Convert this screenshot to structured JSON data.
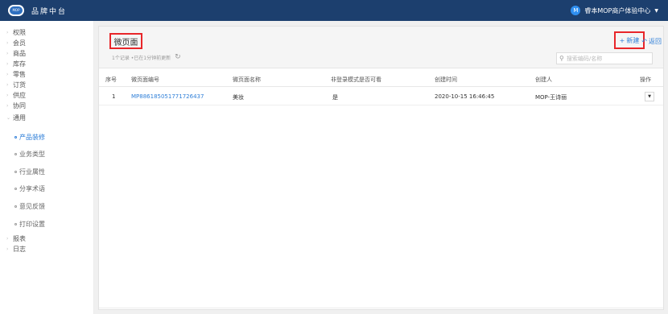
{
  "topbar": {
    "logo_text": "MOP",
    "title": "品牌中台",
    "user_initial": "M",
    "user_name": "睿本MOP商户体验中心",
    "bg_color": "#1c3f6e"
  },
  "sidebar": {
    "items": [
      {
        "label": "权限",
        "icon": "chevron-right-icon"
      },
      {
        "label": "会员",
        "icon": "chevron-right-icon"
      },
      {
        "label": "商品",
        "icon": "chevron-right-icon"
      },
      {
        "label": "库存",
        "icon": "chevron-right-icon"
      },
      {
        "label": "零售",
        "icon": "chevron-right-icon"
      },
      {
        "label": "订货",
        "icon": "chevron-right-icon"
      },
      {
        "label": "供应",
        "icon": "chevron-right-icon"
      },
      {
        "label": "协同",
        "icon": "chevron-right-icon"
      },
      {
        "label": "通用",
        "icon": "chevron-down-icon"
      }
    ],
    "sub_items": [
      {
        "label": "产品装修",
        "active": true
      },
      {
        "label": "业务类型",
        "active": false
      },
      {
        "label": "行业属性",
        "active": false
      },
      {
        "label": "分享术语",
        "active": false
      },
      {
        "label": "意见反馈",
        "active": false
      },
      {
        "label": "打印设置",
        "active": false
      }
    ],
    "bottom_items": [
      {
        "label": "报表",
        "icon": "chevron-right-icon"
      },
      {
        "label": "日志",
        "icon": "chevron-right-icon"
      }
    ],
    "active_color": "#2f7fd8"
  },
  "header": {
    "page_title": "微页面",
    "meta_text": "1个记录 •已在1分钟前更新",
    "new_label": "新建",
    "back_label": "返回",
    "highlight_color": "#e8262a"
  },
  "search": {
    "placeholder": "搜索编码/名称",
    "value": ""
  },
  "table": {
    "columns": [
      "序号",
      "微页面编号",
      "微页面名称",
      "非登录模式是否可看",
      "创建时间",
      "创建人",
      "操作"
    ],
    "rows": [
      {
        "index": "1",
        "code": "MP886185051771726437",
        "name": "美妆",
        "visible_without_login": "是",
        "created_at": "2020-10-15 16:46:45",
        "creator": "MOP-王诗丽"
      }
    ]
  }
}
